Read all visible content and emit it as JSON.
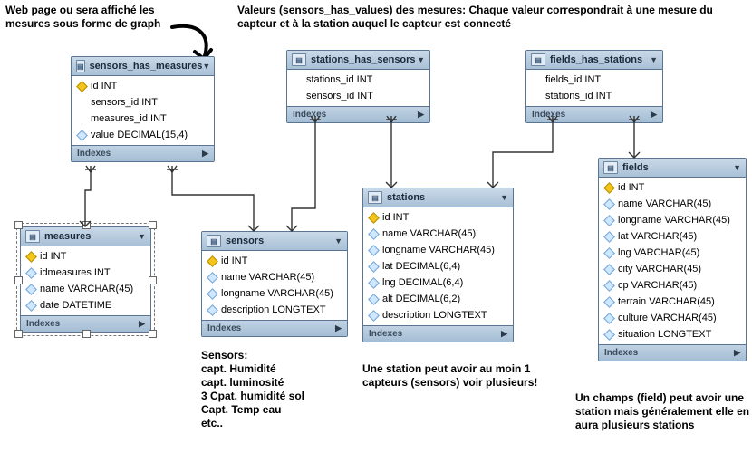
{
  "annotations": {
    "a1": "Web page ou sera affiché les mesures sous forme de graph",
    "a2": "Valeurs  (sensors_has_values) des mesures: Chaque valeur correspondrait à une mesure du capteur et à la station auquel  le capteur est connecté",
    "a3": "Sensors:\ncapt. Humidité\ncapt. luminosité\n3 Cpat. humidité sol\nCapt. Temp eau\netc..",
    "a4": "Une station peut avoir au moin 1 capteurs (sensors) voir plusieurs!",
    "a5": "Un champs (field) peut avoir une station mais généralement elle en aura plusieurs stations"
  },
  "ui": {
    "indexes_label": "Indexes"
  },
  "entities": {
    "sensors_has_measures": {
      "title": "sensors_has_measures",
      "columns": [
        {
          "icon": "pk",
          "text": "id INT"
        },
        {
          "icon": "plain",
          "text": "sensors_id INT"
        },
        {
          "icon": "plain",
          "text": "measures_id INT"
        },
        {
          "icon": "fld",
          "text": "value DECIMAL(15,4)"
        }
      ]
    },
    "stations_has_sensors": {
      "title": "stations_has_sensors",
      "columns": [
        {
          "icon": "plain",
          "text": "stations_id INT"
        },
        {
          "icon": "plain",
          "text": "sensors_id INT"
        }
      ]
    },
    "fields_has_stations": {
      "title": "fields_has_stations",
      "columns": [
        {
          "icon": "plain",
          "text": "fields_id INT"
        },
        {
          "icon": "plain",
          "text": "stations_id INT"
        }
      ]
    },
    "measures": {
      "title": "measures",
      "columns": [
        {
          "icon": "pk",
          "text": "id INT"
        },
        {
          "icon": "fld",
          "text": "idmeasures INT"
        },
        {
          "icon": "fld",
          "text": "name VARCHAR(45)"
        },
        {
          "icon": "fld",
          "text": "date DATETIME"
        }
      ]
    },
    "sensors": {
      "title": "sensors",
      "columns": [
        {
          "icon": "pk",
          "text": "id INT"
        },
        {
          "icon": "fld",
          "text": "name VARCHAR(45)"
        },
        {
          "icon": "fld",
          "text": "longname VARCHAR(45)"
        },
        {
          "icon": "fld",
          "text": "description LONGTEXT"
        }
      ]
    },
    "stations": {
      "title": "stations",
      "columns": [
        {
          "icon": "pk",
          "text": "id INT"
        },
        {
          "icon": "fld",
          "text": "name VARCHAR(45)"
        },
        {
          "icon": "fld",
          "text": "longname VARCHAR(45)"
        },
        {
          "icon": "fld",
          "text": "lat DECIMAL(6,4)"
        },
        {
          "icon": "fld",
          "text": "lng DECIMAL(6,4)"
        },
        {
          "icon": "fld",
          "text": "alt DECIMAL(6,2)"
        },
        {
          "icon": "fld",
          "text": "description LONGTEXT"
        }
      ]
    },
    "fields": {
      "title": "fields",
      "columns": [
        {
          "icon": "pk",
          "text": "id INT"
        },
        {
          "icon": "fld",
          "text": "name VARCHAR(45)"
        },
        {
          "icon": "fld",
          "text": "longname VARCHAR(45)"
        },
        {
          "icon": "fld",
          "text": "lat VARCHAR(45)"
        },
        {
          "icon": "fld",
          "text": "lng VARCHAR(45)"
        },
        {
          "icon": "fld",
          "text": "city VARCHAR(45)"
        },
        {
          "icon": "fld",
          "text": "cp VARCHAR(45)"
        },
        {
          "icon": "fld",
          "text": "terrain VARCHAR(45)"
        },
        {
          "icon": "fld",
          "text": "culture VARCHAR(45)"
        },
        {
          "icon": "fld",
          "text": "situation LONGTEXT"
        }
      ]
    }
  }
}
